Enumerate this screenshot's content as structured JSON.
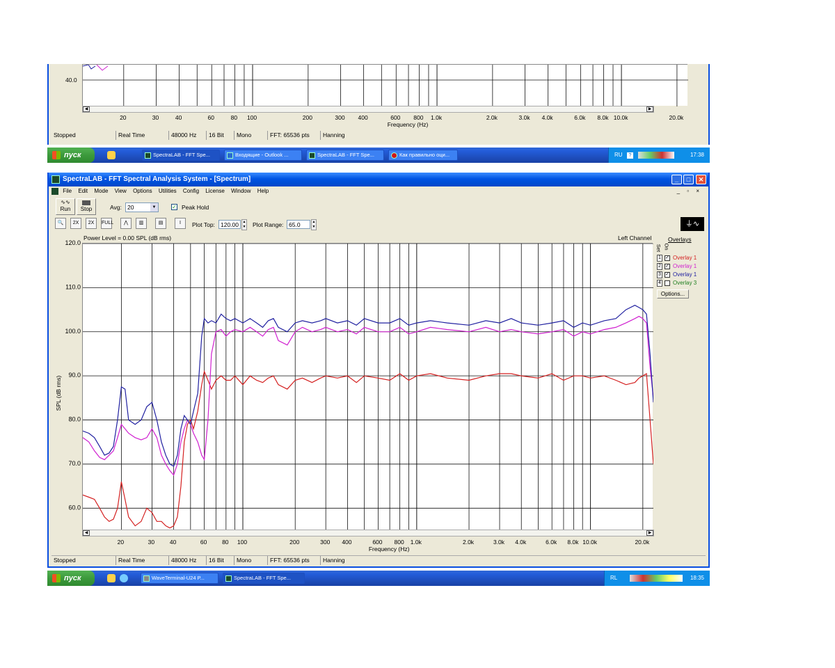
{
  "top_window": {
    "y_tick": "40.0",
    "x_ticks": [
      "20",
      "30",
      "40",
      "60",
      "80",
      "100",
      "200",
      "300",
      "400",
      "600",
      "800",
      "1.0k",
      "2.0k",
      "3.0k",
      "4.0k",
      "6.0k",
      "8.0k",
      "10.0k",
      "20.0k"
    ],
    "x_axis_label": "Frequency (Hz)",
    "status": [
      "Stopped",
      "Real Time",
      "48000 Hz",
      "16 Bit",
      "Mono",
      "FFT: 65536 pts",
      "Hanning"
    ]
  },
  "top_taskbar": {
    "start_label": "пуск",
    "items": [
      "SpectraLAB - FFT Spe...",
      "Входящие - Outlook ...",
      "SpectraLAB - FFT Spe...",
      "Как правильно оци..."
    ],
    "tray_lang": "RU",
    "clock": "17:38"
  },
  "main_window": {
    "title": "SpectraLAB - FFT Spectral Analysis System - [Spectrum]",
    "menu": [
      "File",
      "Edit",
      "Mode",
      "View",
      "Options",
      "Utilities",
      "Config",
      "License",
      "Window",
      "Help"
    ],
    "run_label": "Run",
    "stop_label": "Stop",
    "avg_label": "Avg:",
    "avg_value": "20",
    "peak_hold_label": "Peak Hold",
    "peak_hold_checked": true,
    "plot_top_label": "Plot Top:",
    "plot_top_value": "120.00",
    "plot_range_label": "Plot Range:",
    "plot_range_value": "65.0",
    "power_level": "Power Level = 0.00 SPL (dB rms)",
    "channel": "Left Channel",
    "overlays_title": "Overlays",
    "overlays_set_header": "Set",
    "overlays_on_header": "On",
    "overlays": [
      {
        "set": "1",
        "on": true,
        "name": "Overlay 1",
        "color": "#d42020"
      },
      {
        "set": "2",
        "on": true,
        "name": "Overlay 1",
        "color": "#d020d0"
      },
      {
        "set": "3",
        "on": true,
        "name": "Overlay 1",
        "color": "#2020a0"
      },
      {
        "set": "4",
        "on": false,
        "name": "Overlay 3",
        "color": "#208020"
      }
    ],
    "options_button": "Options...",
    "status": [
      "Stopped",
      "Real Time",
      "48000 Hz",
      "16 Bit",
      "Mono",
      "FFT: 65536 pts",
      "Hanning"
    ]
  },
  "bottom_taskbar": {
    "start_label": "пуск",
    "items": [
      "WaveTerminal-U24 P...",
      "SpectraLAB - FFT Spe..."
    ],
    "tray_lang": "RL",
    "clock": "18:35"
  },
  "chart_data": {
    "type": "line",
    "xlabel": "Frequency (Hz)",
    "ylabel": "SPL (dB rms)",
    "xscale": "log",
    "xlim": [
      12,
      23000
    ],
    "ylim": [
      55,
      120
    ],
    "x_ticks": [
      20,
      30,
      40,
      60,
      80,
      100,
      200,
      300,
      400,
      600,
      800,
      1000,
      2000,
      3000,
      4000,
      6000,
      8000,
      10000,
      20000
    ],
    "x_tick_labels": [
      "20",
      "30",
      "40",
      "60",
      "80",
      "100",
      "200",
      "300",
      "400",
      "600",
      "800",
      "1.0k",
      "2.0k",
      "3.0k",
      "4.0k",
      "6.0k",
      "8.0k",
      "10.0k",
      "20.0k"
    ],
    "y_ticks": [
      60,
      70,
      80,
      90,
      100,
      110,
      120
    ],
    "y_tick_labels": [
      "60.0",
      "70.0",
      "80.0",
      "90.0",
      "100.0",
      "110.0",
      "120.0"
    ],
    "grid": true,
    "series": [
      {
        "name": "Overlay 1",
        "color": "#d42020",
        "x": [
          12,
          13,
          14,
          15,
          16,
          17,
          18,
          19,
          20,
          21,
          22,
          24,
          26,
          28,
          30,
          32,
          34,
          36,
          38,
          40,
          42,
          44,
          46,
          48,
          50,
          52,
          55,
          58,
          60,
          63,
          66,
          70,
          75,
          80,
          85,
          90,
          100,
          110,
          120,
          130,
          140,
          150,
          160,
          180,
          200,
          220,
          250,
          280,
          300,
          350,
          400,
          450,
          500,
          600,
          700,
          800,
          900,
          1000,
          1200,
          1500,
          2000,
          2500,
          3000,
          3500,
          4000,
          5000,
          6000,
          7000,
          8000,
          9000,
          10000,
          12000,
          14000,
          16000,
          18000,
          19000,
          20000,
          21000,
          22000,
          23000
        ],
        "y": [
          63,
          62.5,
          62,
          60,
          58,
          57,
          57.5,
          60,
          66,
          62,
          58,
          56,
          57,
          60,
          59,
          57,
          57,
          56,
          55.5,
          56,
          58,
          65,
          75,
          79,
          80,
          78,
          82,
          88,
          91,
          89,
          87,
          89,
          90,
          89,
          89,
          90,
          88,
          90,
          89,
          88.5,
          89.5,
          90,
          88,
          87,
          89,
          89.5,
          88.5,
          89.5,
          90,
          89.5,
          90,
          88.5,
          90,
          89.5,
          89,
          90.5,
          89,
          90,
          90.5,
          89.5,
          89,
          90,
          90.5,
          90.5,
          90,
          89.5,
          90.5,
          89,
          90,
          90,
          89.5,
          90,
          89,
          88,
          88.5,
          89.5,
          90,
          90.5,
          80,
          70
        ]
      },
      {
        "name": "Overlay 1",
        "color": "#d020d0",
        "x": [
          12,
          13,
          14,
          15,
          16,
          17,
          18,
          19,
          20,
          21,
          22,
          24,
          26,
          28,
          30,
          32,
          34,
          36,
          38,
          40,
          42,
          44,
          46,
          48,
          50,
          52,
          55,
          58,
          60,
          63,
          66,
          70,
          75,
          80,
          85,
          90,
          100,
          110,
          120,
          130,
          140,
          150,
          160,
          180,
          200,
          220,
          250,
          280,
          300,
          350,
          400,
          450,
          500,
          600,
          700,
          800,
          900,
          1000,
          1200,
          1500,
          2000,
          2500,
          3000,
          3500,
          4000,
          5000,
          6000,
          7000,
          8000,
          9000,
          10000,
          12000,
          14000,
          16000,
          18000,
          19000,
          20000,
          21000,
          22000,
          23000
        ],
        "y": [
          76,
          75,
          73,
          71.5,
          71,
          72,
          73,
          76,
          79,
          78,
          77,
          76,
          75.5,
          76,
          78,
          76,
          72,
          70,
          68.5,
          67.5,
          70,
          75,
          78,
          80,
          79,
          77,
          75,
          72,
          71,
          80,
          95,
          100,
          100.5,
          99,
          100,
          100.5,
          100,
          101,
          100,
          99,
          100.5,
          101,
          98,
          97,
          100,
          101,
          100,
          100.5,
          101,
          100,
          100.5,
          99.5,
          101,
          100,
          100,
          101,
          99.5,
          100,
          101,
          100.5,
          100,
          101,
          100,
          100.5,
          100,
          99.5,
          100,
          100.5,
          99,
          100,
          99.5,
          100.5,
          101,
          102,
          103,
          103.5,
          103,
          102,
          92,
          85
        ]
      },
      {
        "name": "Overlay 1",
        "color": "#2020a0",
        "x": [
          12,
          13,
          14,
          15,
          16,
          17,
          18,
          19,
          20,
          21,
          22,
          24,
          26,
          28,
          30,
          32,
          34,
          36,
          38,
          40,
          42,
          44,
          46,
          48,
          50,
          52,
          55,
          58,
          60,
          63,
          66,
          70,
          75,
          80,
          85,
          90,
          100,
          110,
          120,
          130,
          140,
          150,
          160,
          180,
          200,
          220,
          250,
          280,
          300,
          350,
          400,
          450,
          500,
          600,
          700,
          800,
          900,
          1000,
          1200,
          1500,
          2000,
          2500,
          3000,
          3500,
          4000,
          5000,
          6000,
          7000,
          8000,
          9000,
          10000,
          12000,
          14000,
          16000,
          18000,
          19000,
          20000,
          21000,
          22000,
          23000
        ],
        "y": [
          77.5,
          77,
          76,
          74,
          72,
          72.5,
          74,
          80,
          87.5,
          87,
          80,
          79,
          80,
          83,
          84,
          80,
          75,
          72,
          70,
          69.5,
          72,
          78,
          81,
          80,
          79,
          82,
          86,
          99,
          103,
          102,
          102.5,
          102,
          104,
          103,
          102.5,
          103,
          102,
          103,
          102,
          101,
          102.5,
          103,
          101,
          100,
          102,
          102.5,
          102,
          102.5,
          103,
          102,
          102.5,
          101.5,
          103,
          102,
          102,
          103,
          101.5,
          102,
          102.5,
          102,
          101.5,
          102.5,
          102,
          103,
          102,
          101.5,
          102,
          102.5,
          101,
          102,
          101.5,
          102.5,
          103,
          105,
          106,
          105.5,
          105,
          104,
          95,
          84
        ]
      }
    ]
  }
}
